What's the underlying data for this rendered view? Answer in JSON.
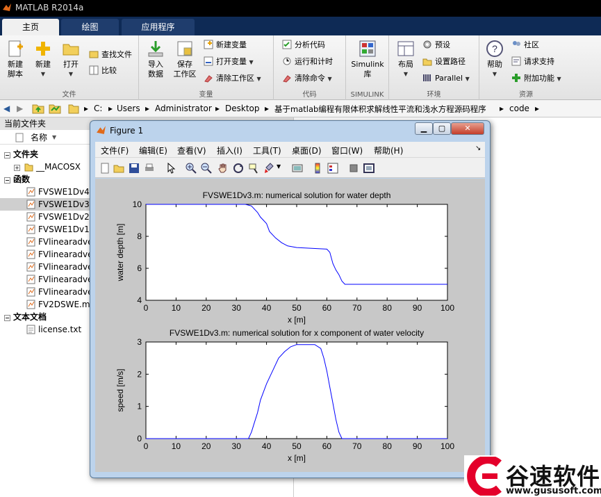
{
  "app": {
    "title": "MATLAB R2014a",
    "tabs": [
      "主页",
      "绘图",
      "应用程序"
    ]
  },
  "ribbon": {
    "file_group": "文件",
    "variable_group": "变量",
    "code_group": "代码",
    "simulink_group": "SIMULINK",
    "env_group": "环境",
    "resources_group": "资源",
    "new_script": "新建\n脚本",
    "new": "新建",
    "open": "打开",
    "find_files": "查找文件",
    "compare": "比较",
    "import_data": "导入\n数据",
    "save_workspace": "保存\n工作区",
    "new_variable": "新建变量",
    "open_variable": "打开变量",
    "clear_workspace": "清除工作区",
    "analyze_code": "分析代码",
    "run_and_time": "运行和计时",
    "clear_commands": "清除命令",
    "simulink": "Simulink\n库",
    "layout": "布局",
    "preferences": "预设",
    "set_path": "设置路径",
    "parallel": "Parallel",
    "help": "帮助",
    "community": "社区",
    "request_support": "请求支持",
    "add_ons": "附加功能"
  },
  "address": {
    "segments": [
      "C:",
      "Users",
      "Administrator",
      "Desktop",
      "基于matlab编程有限体积求解线性平流和浅水方程源码程序",
      "code"
    ]
  },
  "current_folder": {
    "title": "当前文件夹",
    "name_col": "名称",
    "rows": [
      {
        "label": "文件夹",
        "kind": "section"
      },
      {
        "label": "__MACOSX",
        "kind": "folder"
      },
      {
        "label": "函数",
        "kind": "section"
      },
      {
        "label": "FVSWE1Dv4.",
        "kind": "mfile"
      },
      {
        "label": "FVSWE1Dv3.",
        "kind": "mfile"
      },
      {
        "label": "FVSWE1Dv2.",
        "kind": "mfile"
      },
      {
        "label": "FVSWE1Dv1.",
        "kind": "mfile"
      },
      {
        "label": "FVlinearadve",
        "kind": "mfile"
      },
      {
        "label": "FVlinearadve",
        "kind": "mfile"
      },
      {
        "label": "FVlinearadve",
        "kind": "mfile"
      },
      {
        "label": "FVlinearadve",
        "kind": "mfile"
      },
      {
        "label": "FVlinearadve",
        "kind": "mfile"
      },
      {
        "label": "FV2DSWE.m",
        "kind": "mfile"
      },
      {
        "label": "文本文档",
        "kind": "section"
      },
      {
        "label": "license.txt",
        "kind": "txt"
      }
    ]
  },
  "figure": {
    "title": "Figure 1",
    "menu": [
      "文件(F)",
      "编辑(E)",
      "查看(V)",
      "插入(I)",
      "工具(T)",
      "桌面(D)",
      "窗口(W)",
      "帮助(H)"
    ]
  },
  "chart_data": [
    {
      "type": "line",
      "title": "FVSWE1Dv3.m: numerical solution for water depth",
      "xlabel": "x [m]",
      "ylabel": "water depth [m]",
      "xlim": [
        0,
        100
      ],
      "ylim": [
        4,
        10
      ],
      "xticks": [
        "0",
        "10",
        "20",
        "30",
        "40",
        "50",
        "60",
        "70",
        "80",
        "90",
        "100"
      ],
      "yticks": [
        "4",
        "6",
        "8",
        "10"
      ],
      "series": [
        {
          "color": "#0000ff",
          "x": [
            0,
            33,
            35,
            37,
            38,
            40,
            41,
            43,
            45,
            47,
            50,
            55,
            60,
            61,
            62,
            63,
            64,
            65,
            66,
            70,
            80,
            90,
            100
          ],
          "y": [
            10,
            10,
            9.9,
            9.5,
            9.2,
            8.8,
            8.3,
            7.9,
            7.6,
            7.4,
            7.3,
            7.25,
            7.2,
            7.0,
            6.3,
            5.9,
            5.6,
            5.2,
            5.0,
            5.0,
            5.0,
            5.0,
            5.0
          ]
        }
      ]
    },
    {
      "type": "line",
      "title": "FVSWE1Dv3.m: numerical solution for x component of water velocity",
      "xlabel": "x [m]",
      "ylabel": "speed [m/s]",
      "xlim": [
        0,
        100
      ],
      "ylim": [
        0,
        3
      ],
      "xticks": [
        "0",
        "10",
        "20",
        "30",
        "40",
        "50",
        "60",
        "70",
        "80",
        "90",
        "100"
      ],
      "yticks": [
        "0",
        "1",
        "2",
        "3"
      ],
      "series": [
        {
          "color": "#0000ff",
          "x": [
            0,
            34,
            35,
            36,
            37,
            38,
            40,
            42,
            44,
            46,
            48,
            50,
            56,
            58,
            59,
            60,
            61,
            62,
            63,
            64,
            65,
            66,
            70,
            80,
            90,
            100
          ],
          "y": [
            0,
            0,
            0.2,
            0.5,
            0.8,
            1.2,
            1.7,
            2.1,
            2.5,
            2.7,
            2.85,
            2.92,
            2.92,
            2.8,
            2.5,
            2.1,
            1.6,
            1.1,
            0.6,
            0.2,
            0,
            0,
            0,
            0,
            0,
            0
          ]
        }
      ]
    }
  ],
  "watermark": {
    "brand": "谷速软件",
    "url": "www.gususoft.com"
  }
}
